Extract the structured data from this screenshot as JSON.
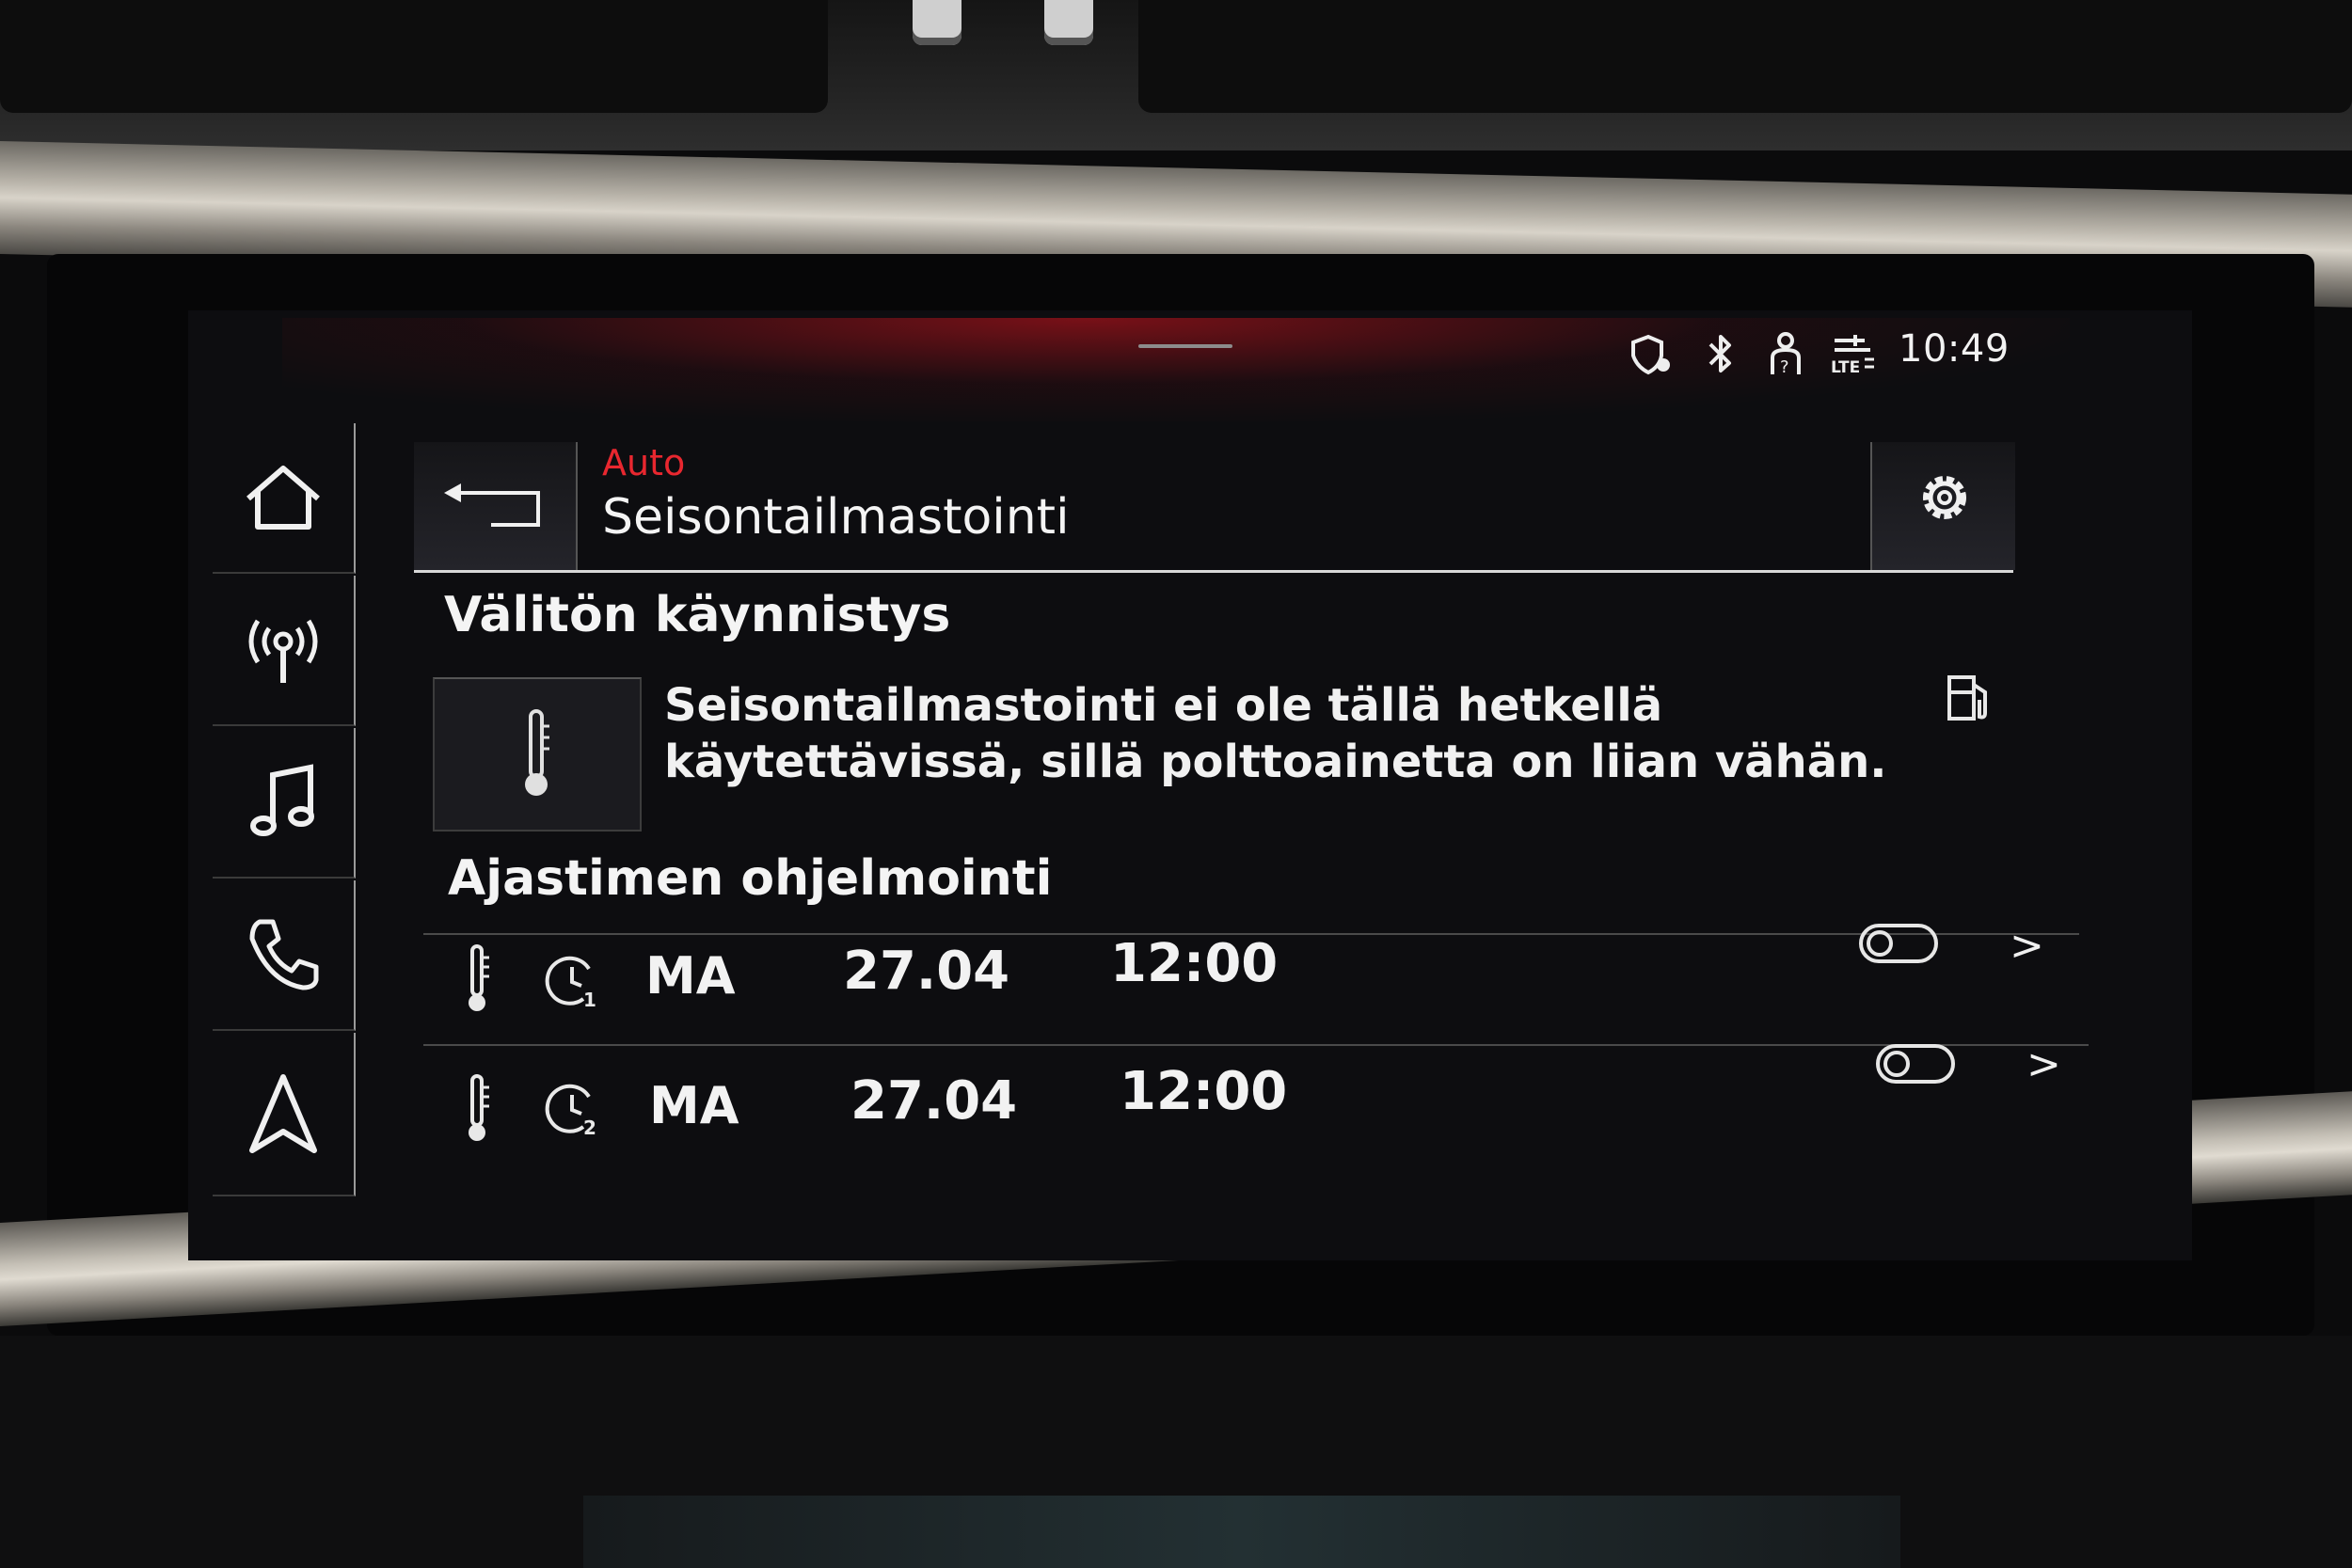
{
  "status_bar": {
    "time": "10:49",
    "icons": [
      "security-map-icon",
      "bluetooth-icon",
      "person-info-icon",
      "lte-signal-icon"
    ]
  },
  "side_nav": {
    "items": [
      {
        "name": "home",
        "icon": "home-icon"
      },
      {
        "name": "radio",
        "icon": "radio-antenna-icon"
      },
      {
        "name": "media",
        "icon": "music-note-icon"
      },
      {
        "name": "phone",
        "icon": "phone-icon"
      },
      {
        "name": "navigation",
        "icon": "navigation-arrow-icon"
      }
    ]
  },
  "header": {
    "breadcrumb": "Auto",
    "title": "Seisontailmastointi",
    "back_icon": "back-arrow-icon",
    "settings_icon": "gear-icon"
  },
  "immediate_start": {
    "title": "Välitön käynnistys",
    "message_line1": "Seisontailmastointi ei ole tällä hetkellä",
    "message_line2": "käytettävissä, sillä polttoainetta on liian vähän.",
    "tile_icon": "thermometer-icon",
    "status_icon": "fuel-pump-icon"
  },
  "timer_programming": {
    "title": "Ajastimen ohjelmointi",
    "rows": [
      {
        "timer_number": "1",
        "day": "MA",
        "date": "27.04",
        "time": "12:00",
        "enabled": false
      },
      {
        "timer_number": "2",
        "day": "MA",
        "date": "27.04",
        "time": "12:00",
        "enabled": false
      }
    ],
    "chevron": ">"
  },
  "colors": {
    "accent_red": "#e8272f",
    "text": "#f2f2f2",
    "screen_bg": "#0d0d10"
  }
}
